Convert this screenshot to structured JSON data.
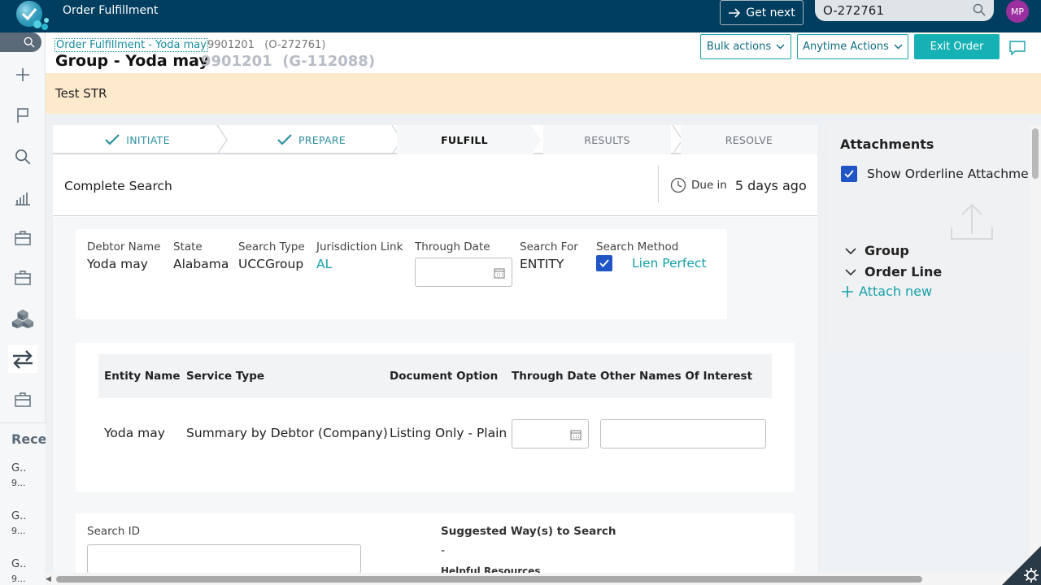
{
  "header": {
    "app_title": "Order Fulfillment",
    "get_next_label": "Get next",
    "search_value": "O-272761",
    "avatar_initials": "MP"
  },
  "case": {
    "breadcrumb_link": "Order Fulfillment - Yoda may",
    "breadcrumb_ids": "9901201   (O-272761)",
    "title": "Group - Yoda may",
    "subtitle": "9901201  (G-112088)",
    "bulk_actions_label": "Bulk actions",
    "anytime_actions_label": "Anytime Actions",
    "exit_order_label": "Exit Order",
    "banner_text": "Test STR"
  },
  "stages": [
    {
      "label": "INITIATE",
      "status": "done"
    },
    {
      "label": "PREPARE",
      "status": "done"
    },
    {
      "label": "FULFILL",
      "status": "current"
    },
    {
      "label": "RESULTS",
      "status": "future"
    },
    {
      "label": "RESOLVE",
      "status": "future"
    }
  ],
  "step": {
    "title": "Complete Search",
    "due_label": "Due in",
    "due_value": "5 days ago"
  },
  "search_info": {
    "debtor_name_label": "Debtor Name",
    "debtor_name": "Yoda may",
    "state_label": "State",
    "state": "Alabama",
    "search_type_label": "Search Type",
    "search_type": "UCCGroup",
    "jurisdiction_label": "Jurisdiction Link",
    "jurisdiction": "AL",
    "through_date_label": "Through Date",
    "through_date": "",
    "search_for_label": "Search For",
    "search_for": "ENTITY",
    "search_method_label": "Search Method",
    "search_method_checked": true,
    "search_method": "Lien Perfect"
  },
  "entity_table": {
    "columns": [
      "Entity Name",
      "Service Type",
      "Document Option",
      "Through Date",
      "Other Names Of Interest"
    ],
    "rows": [
      {
        "entity_name": "Yoda may",
        "service_type": "Summary by Debtor (Company)",
        "document_option": "Listing Only - Plain",
        "through_date": "",
        "other_names": ""
      }
    ]
  },
  "search_details": {
    "search_id_label": "Search ID",
    "search_id_value": "",
    "suggested_label": "Suggested Way(s) to Search",
    "suggested_value": "-",
    "helpful_label": "Helpful Resources"
  },
  "attachments": {
    "title": "Attachments",
    "show_orderline_label": "Show Orderline Attachments",
    "show_orderline_checked": true,
    "groups": [
      "Group",
      "Order Line"
    ],
    "attach_new_label": "Attach new"
  },
  "recent": {
    "title": "Recent",
    "items": [
      {
        "line1": "G..",
        "line2": "9..."
      },
      {
        "line1": "G..",
        "line2": "9..."
      },
      {
        "line1": "G..",
        "line2": "9..."
      }
    ]
  },
  "colors": {
    "header_bg": "#003e5f",
    "accent_teal": "#16b1b4",
    "link_teal": "#16a0a8",
    "banner_bg": "#fde9cc",
    "checkbox_blue": "#1f55c4",
    "avatar_purple": "#9c2fa0"
  }
}
